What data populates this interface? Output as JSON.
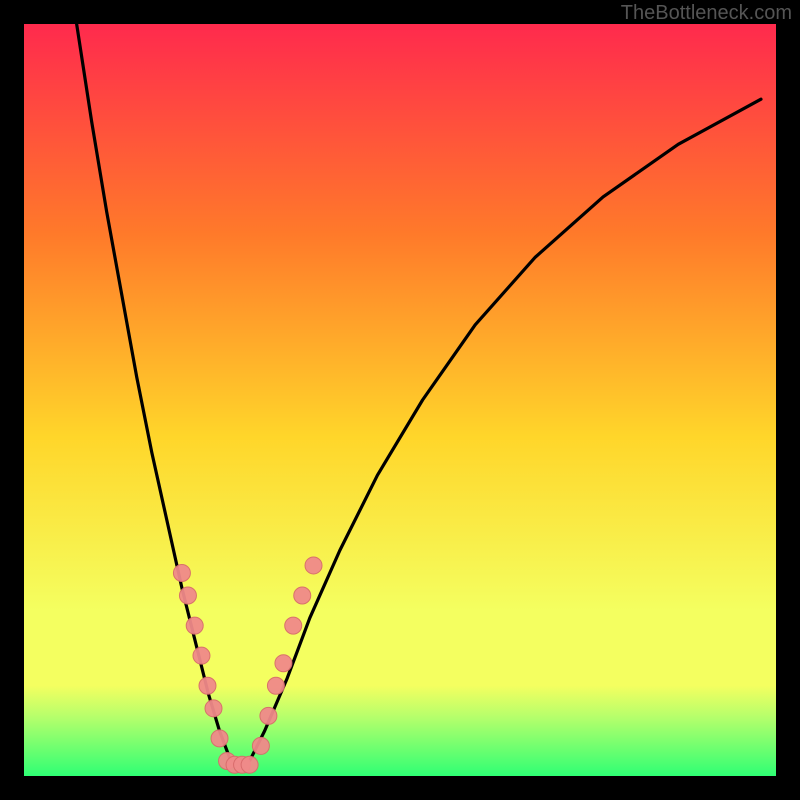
{
  "watermark": {
    "text": "TheBottleneck.com"
  },
  "colors": {
    "gradient_top": "#ff2a4d",
    "gradient_mid1": "#ff7a2a",
    "gradient_mid2": "#ffd62a",
    "gradient_low": "#f4ff60",
    "gradient_green1": "#b8ff6b",
    "gradient_green2": "#2fff74",
    "frame": "#000000",
    "curve": "#000000",
    "marker_fill": "#f08a8a",
    "marker_stroke": "#d86b6b"
  },
  "chart_data": {
    "type": "line",
    "title": "",
    "xlabel": "",
    "ylabel": "",
    "xlim": [
      0,
      100
    ],
    "ylim": [
      0,
      100
    ],
    "grid": false,
    "legend": false,
    "series": [
      {
        "name": "curve_left",
        "x": [
          7,
          9,
          11,
          13,
          15,
          17,
          19,
          21,
          23,
          24.5,
          26,
          27.5
        ],
        "y": [
          100,
          87,
          75,
          64,
          53,
          43,
          34,
          25,
          17,
          11,
          6,
          2
        ]
      },
      {
        "name": "curve_right",
        "x": [
          30,
          32,
          35,
          38,
          42,
          47,
          53,
          60,
          68,
          77,
          87,
          98
        ],
        "y": [
          2,
          6,
          13,
          21,
          30,
          40,
          50,
          60,
          69,
          77,
          84,
          90
        ]
      }
    ],
    "markers_left": [
      {
        "x": 21.0,
        "y": 27
      },
      {
        "x": 21.8,
        "y": 24
      },
      {
        "x": 22.7,
        "y": 20
      },
      {
        "x": 23.6,
        "y": 16
      },
      {
        "x": 24.4,
        "y": 12
      },
      {
        "x": 25.2,
        "y": 9
      },
      {
        "x": 26.0,
        "y": 5
      },
      {
        "x": 27.0,
        "y": 2
      },
      {
        "x": 28.0,
        "y": 1.5
      },
      {
        "x": 29.0,
        "y": 1.5
      },
      {
        "x": 30.0,
        "y": 1.5
      }
    ],
    "markers_right": [
      {
        "x": 31.5,
        "y": 4
      },
      {
        "x": 32.5,
        "y": 8
      },
      {
        "x": 33.5,
        "y": 12
      },
      {
        "x": 34.5,
        "y": 15
      },
      {
        "x": 35.8,
        "y": 20
      },
      {
        "x": 37.0,
        "y": 24
      },
      {
        "x": 38.5,
        "y": 28
      }
    ]
  }
}
